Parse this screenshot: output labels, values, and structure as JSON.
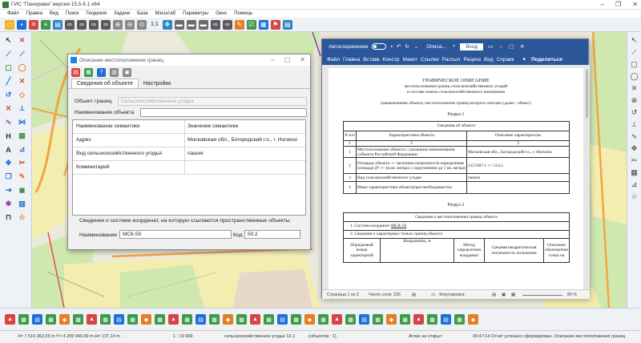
{
  "app": {
    "title": "ГИС \"Панорама\" версия 15.5.6.1 x64"
  },
  "menu": [
    "Файл",
    "Правка",
    "Вид",
    "Поиск",
    "Геодезия",
    "Задачи",
    "База",
    "Масштаб",
    "Параметры",
    "Окно",
    "Помощь"
  ],
  "toolbar": {
    "scale_text": "1:1"
  },
  "dialog": {
    "title": "Описание местоположения границ",
    "tabs": [
      "Сведения об объекте",
      "Настройки"
    ],
    "object_label": "Объект границ",
    "object_value": "Сельскохозяйственное угодье",
    "name_label": "Наименование объекта",
    "name_value": "",
    "table_headers": [
      "Наименование семантики",
      "Значение семантики"
    ],
    "rows": [
      {
        "name": "Адрес",
        "value": "Московская обл., Богородский г.о., г. Ногинск"
      },
      {
        "name": "Вид сельскохозяйственного угодья",
        "value": "пашня"
      },
      {
        "name": "Комментарий",
        "value": ""
      }
    ],
    "coord_caption": "Сведения о системе координат, на которую ссылаются пространственные объекты",
    "coord_name_label": "Наименование",
    "coord_name_value": "МСК-50",
    "coord_code_label": "Код",
    "coord_code_value": "50.2"
  },
  "word": {
    "autosave_label": "Автосохранение",
    "doc_title": "Описа...",
    "login": "Вход",
    "ribbon_tabs": [
      "Файл",
      "Главна",
      "Вставк",
      "Констр",
      "Макет",
      "Ссылки",
      "Рассыл",
      "Реценз",
      "Вид",
      "Справк"
    ],
    "share": "Поделиться",
    "doc": {
      "heading": "ГРАФИЧЕСКОЕ ОПИСАНИЕ",
      "sub1": "местоположения границ сельскохозяйственных угодий",
      "sub2": "в составе земель сельскохозяйственного назначения",
      "note": "(наименование объекта, местоположение границ которого описано (далее - объект)",
      "section1": "Раздел 1",
      "info_title": "Сведения об объекте",
      "col_num": "N п/п",
      "col_char": "Характеристики объекта",
      "col_desc": "Описание характеристик",
      "idx": [
        "1",
        "2",
        "3"
      ],
      "rows": [
        {
          "n": "1",
          "c": "Местоположение объекта с указанием наименования субъекта Российской Федерации",
          "d": "Московская обл., Богородский г.о., г. Ногинск"
        },
        {
          "n": "2",
          "c": "Площадь объекта +/- величина погрешности определения площади (Р +/- (в кв. метрах с округлением до 1 кв. метра)",
          "d": "2157467.1 +/- 514.1"
        },
        {
          "n": "3",
          "c": "Вид сельскохозяйственного угодья",
          "d": "пашня"
        },
        {
          "n": "4",
          "c": "Иные характеристики объекта(при необходимости)",
          "d": ""
        }
      ],
      "section2": "Раздел 2",
      "bound_title": "Сведения о местоположении границ объекта",
      "cs_label": "1. Система координат",
      "cs_value": "МСК-50",
      "points_label": "2. Сведения о характерных точках границ объекта",
      "pt_headers": [
        "Порядковый номер характерной",
        "Координаты, м",
        "Метод определения координат",
        "Средняя квадратическая погрешность положения",
        "Описание обозначения точки на"
      ]
    },
    "status_page": "Страница 1 из 3",
    "status_words": "Число слов: 235",
    "status_focus": "Фокусировка",
    "zoom": "80 %"
  },
  "status": {
    "coords": "X= 7 516 062,55 m   Y= 4 259 940,69 m   H= 137,14 m",
    "scale": "1 : 19 999",
    "layer": "сельскохозяйственное угодье 12-1",
    "objects": "(объектов : 1)",
    "atlas": "Атлас не открыт",
    "message": "09:47:14  Отчет успешно сформирован. Описание местоположения границ"
  },
  "colors": {
    "word_blue": "#2b579a",
    "map_green": "#cfe8b0",
    "map_yellow": "#f3eeb0"
  }
}
